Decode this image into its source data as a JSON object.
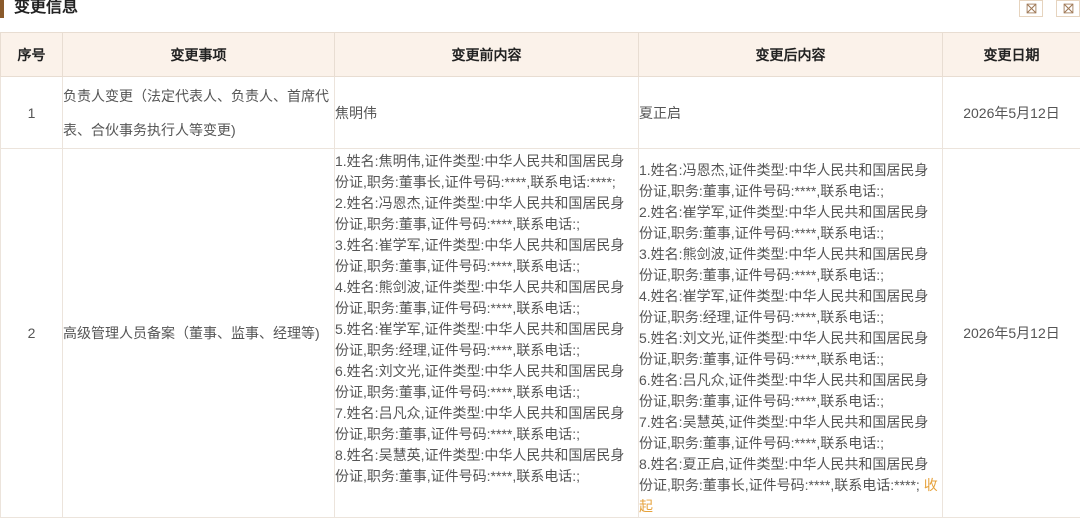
{
  "section": {
    "title": "变更信息"
  },
  "table": {
    "headers": [
      "序号",
      "变更事项",
      "变更前内容",
      "变更后内容",
      "变更日期"
    ],
    "rows": [
      {
        "index": "1",
        "item": "负责人变更（法定代表人、负责人、首席代表、合伙事务执行人等变更)",
        "before": "焦明伟",
        "after": "夏正启",
        "date": "2026年5月12日"
      },
      {
        "index": "2",
        "item": "高级管理人员备案（董事、监事、经理等)",
        "before_entries": [
          "1.姓名:焦明伟,证件类型:中华人民共和国居民身份证,职务:董事长,证件号码:****,联系电话:****;",
          "2.姓名:冯恩杰,证件类型:中华人民共和国居民身份证,职务:董事,证件号码:****,联系电话:;",
          "3.姓名:崔学军,证件类型:中华人民共和国居民身份证,职务:董事,证件号码:****,联系电话:;",
          "4.姓名:熊剑波,证件类型:中华人民共和国居民身份证,职务:董事,证件号码:****,联系电话:;",
          "5.姓名:崔学军,证件类型:中华人民共和国居民身份证,职务:经理,证件号码:****,联系电话:;",
          "6.姓名:刘文光,证件类型:中华人民共和国居民身份证,职务:董事,证件号码:****,联系电话:;",
          "7.姓名:吕凡众,证件类型:中华人民共和国居民身份证,职务:董事,证件号码:****,联系电话:;",
          "8.姓名:吴慧英,证件类型:中华人民共和国居民身份证,职务:董事,证件号码:****,联系电话:;"
        ],
        "after_entries": [
          "1.姓名:冯恩杰,证件类型:中华人民共和国居民身份证,职务:董事,证件号码:****,联系电话:;",
          "2.姓名:崔学军,证件类型:中华人民共和国居民身份证,职务:董事,证件号码:****,联系电话:;",
          "3.姓名:熊剑波,证件类型:中华人民共和国居民身份证,职务:董事,证件号码:****,联系电话:;",
          "4.姓名:崔学军,证件类型:中华人民共和国居民身份证,职务:经理,证件号码:****,联系电话:;",
          "5.姓名:刘文光,证件类型:中华人民共和国居民身份证,职务:董事,证件号码:****,联系电话:;",
          "6.姓名:吕凡众,证件类型:中华人民共和国居民身份证,职务:董事,证件号码:****,联系电话:;",
          "7.姓名:吴慧英,证件类型:中华人民共和国居民身份证,职务:董事,证件号码:****,联系电话:;",
          "8.姓名:夏正启,证件类型:中华人民共和国居民身份证,职务:董事长,证件号码:****,联系电话:****;"
        ],
        "collapse_label": "收起",
        "date": "2026年5月12日"
      }
    ]
  },
  "icons": [
    "expand-icon",
    "close-icon"
  ]
}
